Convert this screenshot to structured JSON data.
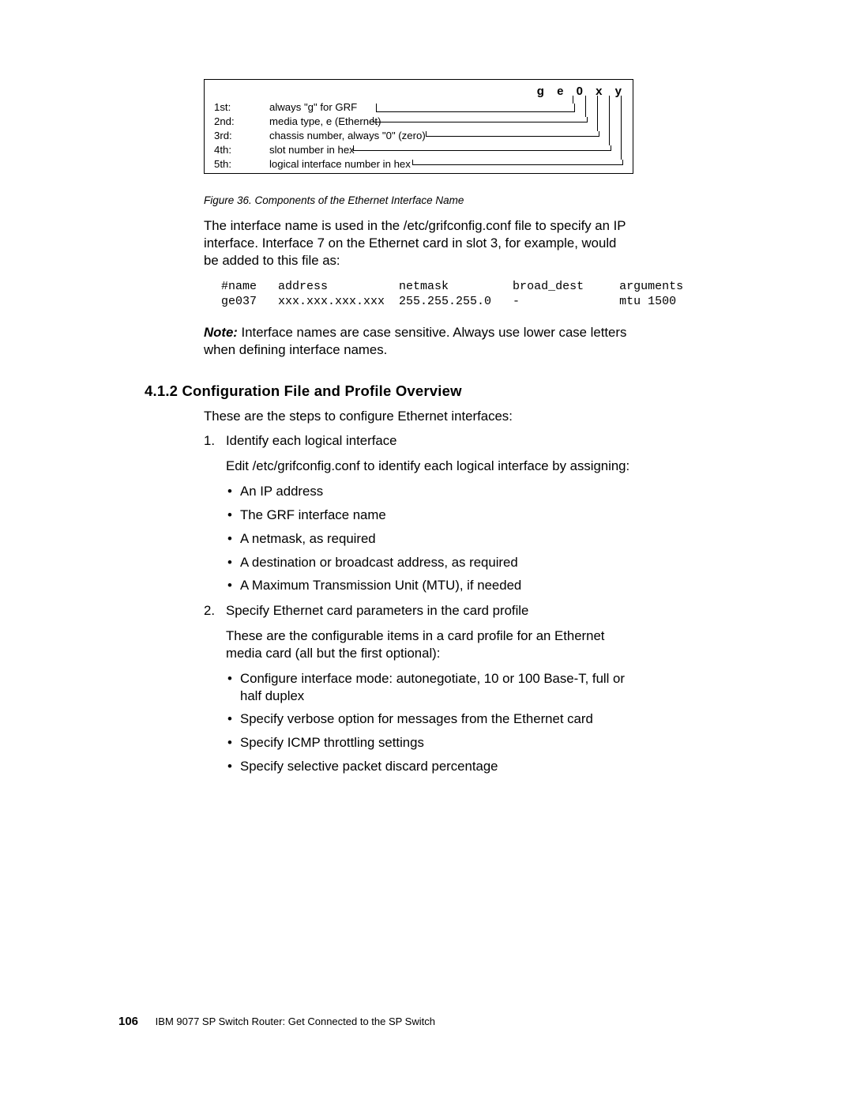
{
  "figure": {
    "header_chars": "g e 0 x y",
    "rows": [
      {
        "ord": "1st:",
        "desc": "always \"g\" for GRF"
      },
      {
        "ord": "2nd:",
        "desc": "media type, e (Ethernet)"
      },
      {
        "ord": "3rd:",
        "desc": "chassis number, always \"0\" (zero)"
      },
      {
        "ord": "4th:",
        "desc": "slot number in hex"
      },
      {
        "ord": "5th:",
        "desc": "logical interface number in hex"
      }
    ],
    "caption": "Figure 36.  Components of the Ethernet Interface Name"
  },
  "para1": "The interface name is used in the /etc/grifconfig.conf file to specify an IP interface. Interface 7 on the Ethernet card in slot 3, for example, would be added to this file as:",
  "code": "#name   address          netmask         broad_dest     arguments\nge037   xxx.xxx.xxx.xxx  255.255.255.0   -              mtu 1500",
  "note_label": "Note:",
  "note_body": " Interface names are case sensitive. Always use lower case letters when defining interface names.",
  "section_heading": "4.1.2  Configuration File and Profile Overview",
  "intro": "These are the steps to configure Ethernet interfaces:",
  "steps": [
    {
      "marker": "1.",
      "title": "Identify each logical interface",
      "sub": "Edit /etc/grifconfig.conf to identify each logical interface by assigning:",
      "bullets": [
        "An IP address",
        "The GRF interface name",
        "A netmask, as required",
        "A destination or broadcast address, as required",
        "A Maximum Transmission Unit (MTU), if needed"
      ]
    },
    {
      "marker": "2.",
      "title": "Specify Ethernet card parameters in the card profile",
      "sub": "These are the configurable items in a card profile for an Ethernet media card (all but the first optional):",
      "bullets": [
        "Configure interface mode: autonegotiate, 10 or 100 Base-T, full or half duplex",
        "Specify verbose option for messages from the Ethernet card",
        "Specify ICMP throttling settings",
        "Specify selective packet discard percentage"
      ]
    }
  ],
  "footer": {
    "page": "106",
    "title": "IBM 9077 SP Switch Router: Get Connected to the SP Switch"
  }
}
